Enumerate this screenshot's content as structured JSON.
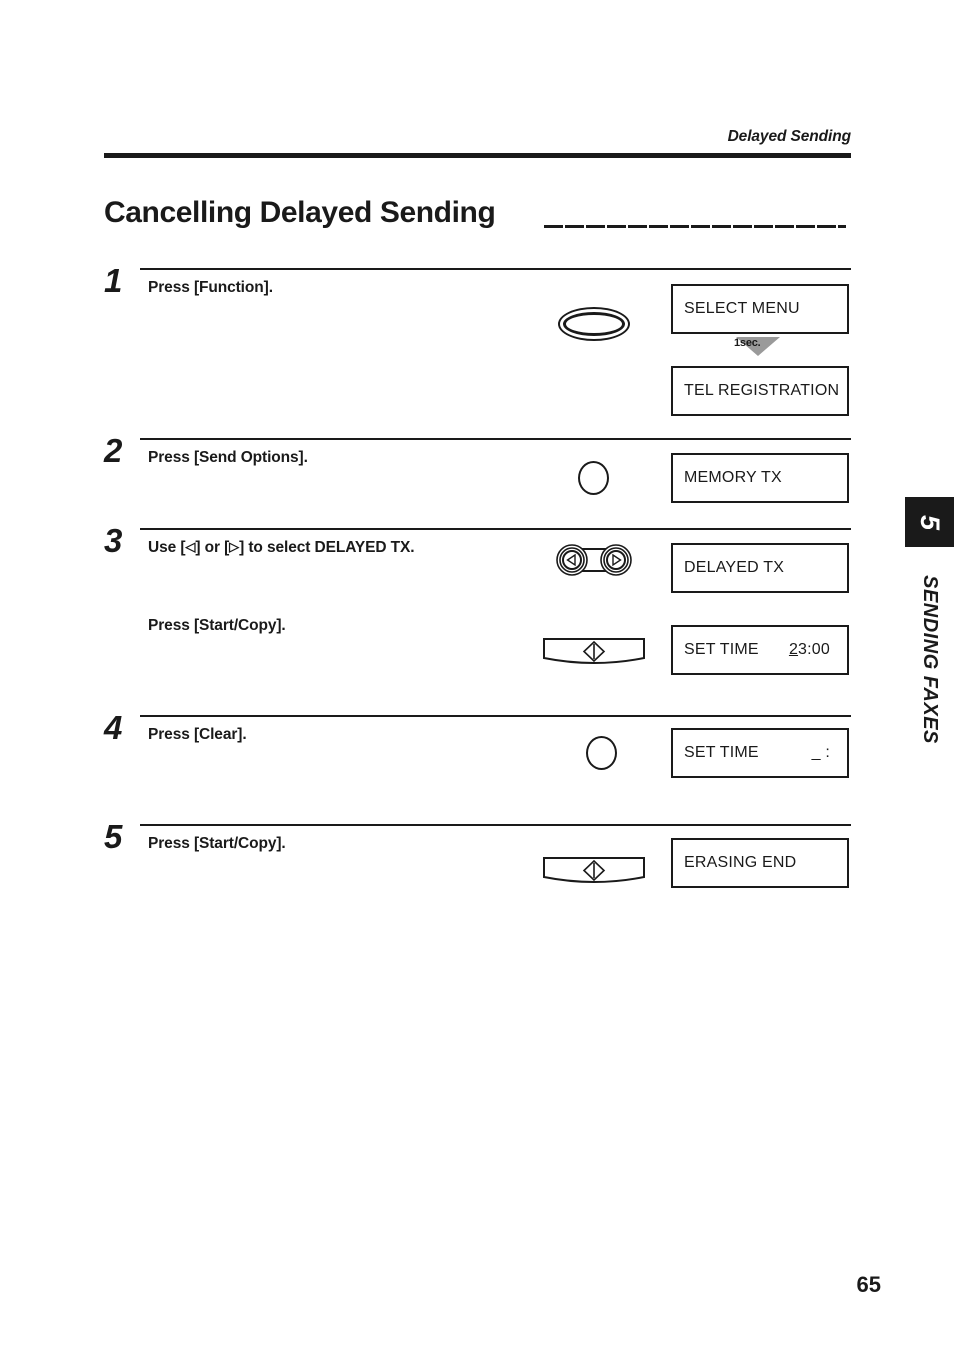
{
  "page": {
    "running_header": "Delayed Sending",
    "title": "Cancelling Delayed Sending",
    "page_number": "65"
  },
  "side_tab": {
    "chapter_number": "5",
    "chapter_name": "SENDING FAXES",
    "background": "#1a1a1a",
    "text_color": "#ffffff"
  },
  "annotations": {
    "hold_duration": "1sec."
  },
  "steps": [
    {
      "number": "1",
      "instruction": "Press [Function].",
      "key_icon": "oval-function-key",
      "displays": [
        {
          "label": "SELECT MENU",
          "value": ""
        },
        {
          "label": "TEL REGISTRATION",
          "value": ""
        }
      ]
    },
    {
      "number": "2",
      "instruction": "Press [Send Options].",
      "key_icon": "round-send-options-key",
      "displays": [
        {
          "label": "MEMORY TX",
          "value": ""
        }
      ]
    },
    {
      "number": "3",
      "instruction_prefix": "Use [",
      "instruction_left_arrow": "◁",
      "instruction_middle": "] or [",
      "instruction_right_arrow": "▷",
      "instruction_suffix": "] to select DELAYED TX.",
      "key_icon": "left-right-rocker-key",
      "displays": [
        {
          "label": "DELAYED TX",
          "value": ""
        }
      ],
      "sub_instruction": "Press [Start/Copy].",
      "sub_key_icon": "start-copy-key",
      "sub_displays": [
        {
          "label": "SET TIME",
          "value_cursor": "2",
          "value_rest": "3:00"
        }
      ]
    },
    {
      "number": "4",
      "instruction": "Press [Clear].",
      "key_icon": "round-clear-key",
      "displays": [
        {
          "label": "SET TIME",
          "value": "_  :"
        }
      ]
    },
    {
      "number": "5",
      "instruction": "Press [Start/Copy].",
      "key_icon": "start-copy-key",
      "displays": [
        {
          "label": "ERASING END",
          "value": ""
        }
      ]
    }
  ]
}
